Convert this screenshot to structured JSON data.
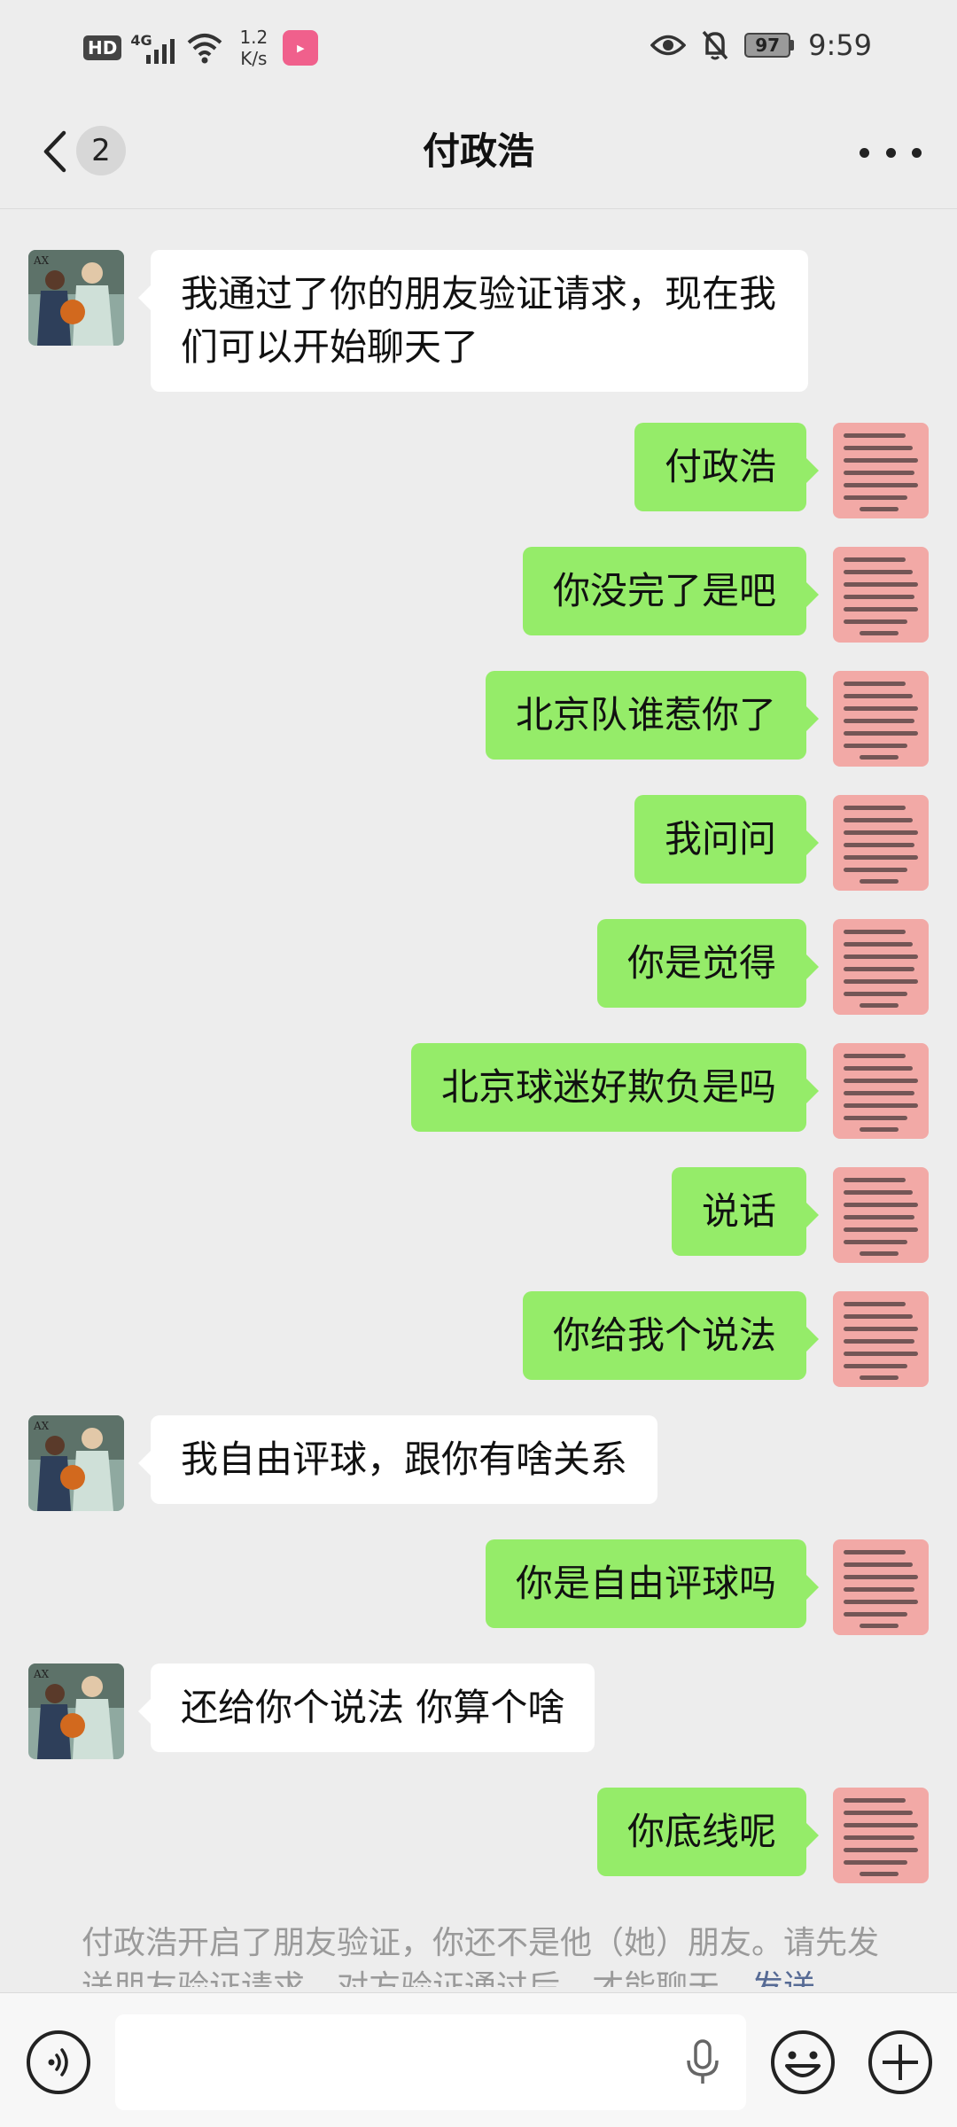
{
  "status_bar": {
    "hd": "HD",
    "network": "4G",
    "speed_value": "1.2",
    "speed_unit": "K/s",
    "battery": "97",
    "time": "9:59"
  },
  "header": {
    "back_icon": "chevron-left-icon",
    "unread_count": "2",
    "title": "付政浩",
    "more_icon": "more-dots-icon"
  },
  "messages": [
    {
      "from": "them",
      "text": "我通过了你的朋友验证请求，现在我们可以开始聊天了"
    },
    {
      "from": "me",
      "text": "付政浩"
    },
    {
      "from": "me",
      "text": "你没完了是吧"
    },
    {
      "from": "me",
      "text": "北京队谁惹你了"
    },
    {
      "from": "me",
      "text": "我问问"
    },
    {
      "from": "me",
      "text": "你是觉得"
    },
    {
      "from": "me",
      "text": "北京球迷好欺负是吗"
    },
    {
      "from": "me",
      "text": "说话"
    },
    {
      "from": "me",
      "text": "你给我个说法"
    },
    {
      "from": "them",
      "text": "我自由评球，跟你有啥关系"
    },
    {
      "from": "me",
      "text": "你是自由评球吗"
    },
    {
      "from": "them",
      "text": "还给你个说法 你算个啥"
    },
    {
      "from": "me",
      "text": "你底线呢"
    }
  ],
  "notice": {
    "text": "付政浩开启了朋友验证，你还不是他（她）朋友。请先发送朋友验证请求，对方验证通过后，才能聊天。",
    "link": "发送"
  },
  "colors": {
    "background": "#ededed",
    "my_bubble": "#95ec69",
    "their_bubble": "#ffffff",
    "link": "#576b95"
  },
  "input_bar": {
    "voice_icon": "voice-icon",
    "mic_icon": "microphone-icon",
    "emoji_icon": "emoji-icon",
    "plus_icon": "plus-icon",
    "input_value": ""
  }
}
